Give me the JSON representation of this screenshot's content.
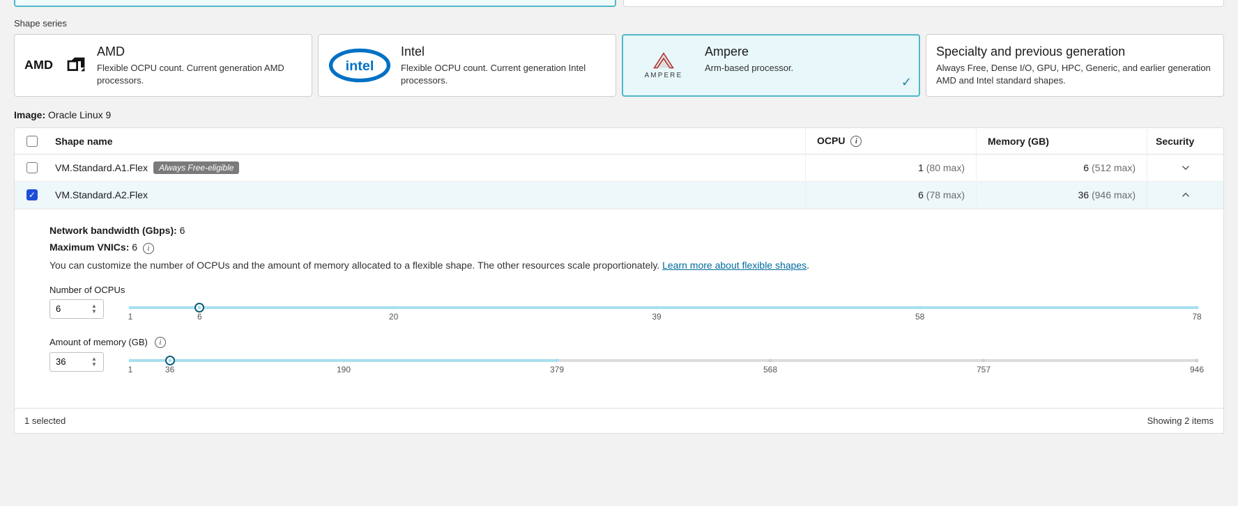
{
  "labels": {
    "shape_series": "Shape series",
    "image_label": "Image:",
    "image_value": "Oracle Linux 9",
    "header_shape_name": "Shape name",
    "header_ocpu": "OCPU",
    "header_memory": "Memory (GB)",
    "header_security": "Security",
    "selected_count": "1 selected",
    "showing": "Showing 2 items"
  },
  "series": {
    "amd": {
      "title": "AMD",
      "desc": "Flexible OCPU count. Current generation AMD processors."
    },
    "intel": {
      "title": "Intel",
      "desc": "Flexible OCPU count. Current generation Intel processors."
    },
    "ampere": {
      "title": "Ampere",
      "desc": "Arm-based processor."
    },
    "specialty": {
      "title": "Specialty and previous generation",
      "desc": "Always Free, Dense I/O, GPU, HPC, Generic, and earlier generation AMD and Intel standard shapes."
    }
  },
  "rows": [
    {
      "name": "VM.Standard.A1.Flex",
      "badge": "Always Free-eligible",
      "ocpu_val": "1",
      "ocpu_max": "(80 max)",
      "mem_val": "6",
      "mem_max": "(512 max)",
      "selected": false,
      "expanded": false
    },
    {
      "name": "VM.Standard.A2.Flex",
      "badge": "",
      "ocpu_val": "6",
      "ocpu_max": "(78 max)",
      "mem_val": "36",
      "mem_max": "(946 max)",
      "selected": true,
      "expanded": true
    }
  ],
  "detail": {
    "bw_label": "Network bandwidth (Gbps):",
    "bw_value": "6",
    "vnic_label": "Maximum VNICs:",
    "vnic_value": "6",
    "desc_pre": "You can customize the number of OCPUs and the amount of memory allocated to a flexible shape. The other resources scale proportionately. ",
    "desc_link": "Learn more about flexible shapes",
    "desc_post": ".",
    "ocpu": {
      "label": "Number of OCPUs",
      "value": "6",
      "ticks": [
        "1",
        "6",
        "20",
        "39",
        "58",
        "78"
      ],
      "tick_pos": [
        0,
        6.49,
        24.68,
        49.35,
        74.03,
        100
      ],
      "fill_pct": 6.49,
      "thumb_pct": 6.49
    },
    "mem": {
      "label": "Amount of memory (GB)",
      "value": "36",
      "ticks": [
        "1",
        "36",
        "190",
        "379",
        "568",
        "757",
        "946"
      ],
      "tick_pos": [
        0,
        3.7,
        20.0,
        40.0,
        60.0,
        80.0,
        100
      ],
      "fill_pct": 40.0,
      "thumb_pct": 3.7,
      "grey_from": 40.0
    }
  }
}
